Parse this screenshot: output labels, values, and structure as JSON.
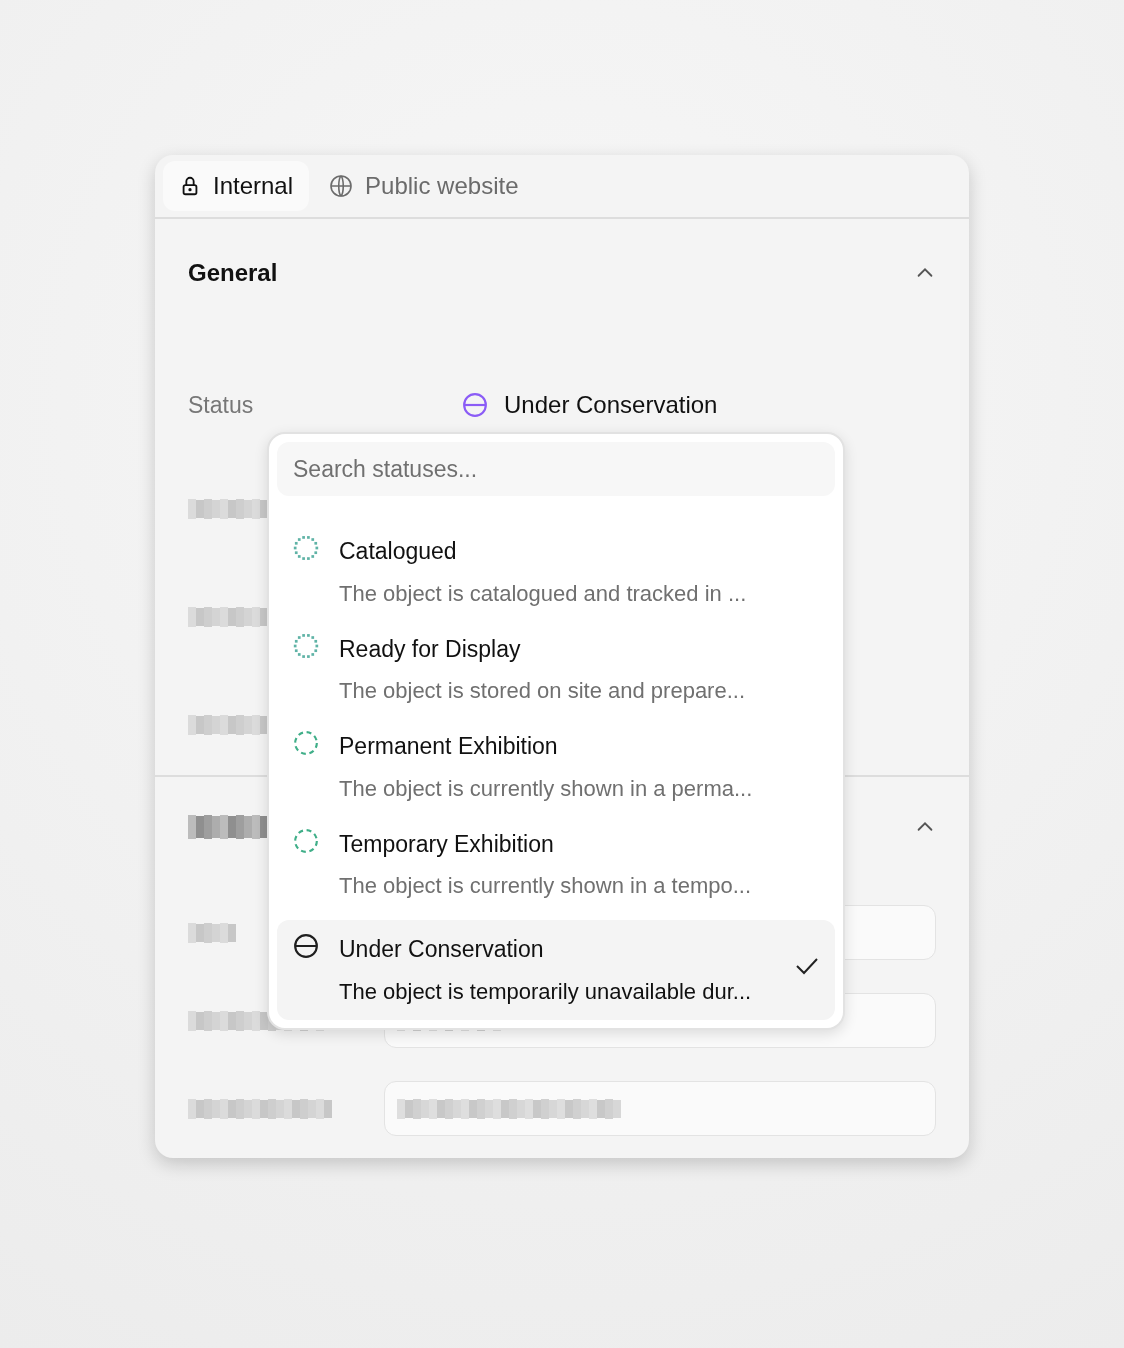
{
  "tabs": [
    {
      "label": "Internal",
      "selected": true
    },
    {
      "label": "Public website",
      "selected": false
    }
  ],
  "general": {
    "title": "General",
    "expanded": true,
    "status": {
      "label": "Status",
      "value": "Under Conservation",
      "color": "#8b5cf6"
    }
  },
  "second_section": {
    "expanded": true
  },
  "status_menu": {
    "placeholder": "Search statuses...",
    "items": [
      {
        "title": "Catalogued",
        "description": "The object is catalogued and tracked in ...",
        "kind": "dotted",
        "color": "#5fb3a6",
        "selected": false
      },
      {
        "title": "Ready for Display",
        "description": "The object is stored on site and prepare...",
        "kind": "dotted",
        "color": "#5fb3a6",
        "selected": false
      },
      {
        "title": "Permanent Exhibition",
        "description": "The object is currently shown in a perma...",
        "kind": "dashed",
        "color": "#3fae88",
        "selected": false
      },
      {
        "title": "Temporary Exhibition",
        "description": "The object is currently shown in a tempo...",
        "kind": "dashed",
        "color": "#3fae88",
        "selected": false
      },
      {
        "title": "Under Conservation",
        "description": "The object is temporarily unavailable dur...",
        "kind": "conservation",
        "color": "#1f1f1f",
        "selected": true
      }
    ]
  }
}
